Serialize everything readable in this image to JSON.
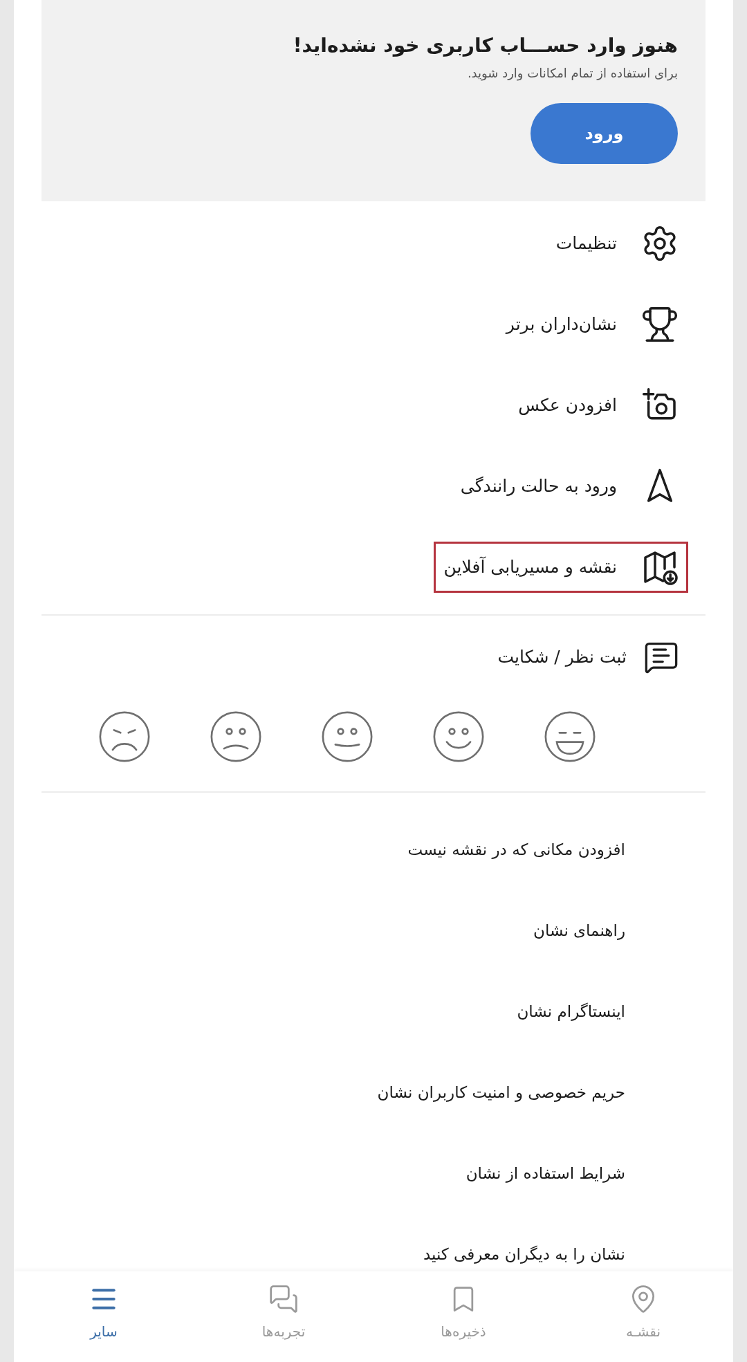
{
  "login_banner": {
    "title": "هنوز وارد حســـاب کاربری خود نشده‌اید!",
    "subtitle": "برای استفاده از تمام امکانات وارد شوید.",
    "button": "ورود"
  },
  "menu_items": [
    {
      "kind": "settings",
      "label": "تنظیمات",
      "highlighted": false
    },
    {
      "kind": "trophy",
      "label": "نشان‌داران برتر",
      "highlighted": false
    },
    {
      "kind": "add-photo",
      "label": "افزودن عکس",
      "highlighted": false
    },
    {
      "kind": "navigation",
      "label": "ورود به حالت رانندگی",
      "highlighted": false
    },
    {
      "kind": "offline-map",
      "label": "نقشه و مسیریابی آفلاین",
      "highlighted": true
    }
  ],
  "feedback": {
    "label": "ثبت نظر / شکایت",
    "faces": [
      {
        "kind": "laughing"
      },
      {
        "kind": "smiling"
      },
      {
        "kind": "neutral"
      },
      {
        "kind": "sad"
      },
      {
        "kind": "angry"
      }
    ]
  },
  "links": [
    "افزودن مکانی که در نقشه نیست",
    "راهنمای نشان",
    "اینستاگرام نشان",
    "حریم خصوصی و امنیت کاربران نشان",
    "شرایط استفاده از نشان",
    "نشان را به دیگران معرفی کنید"
  ],
  "bottom_nav": [
    {
      "kind": "map",
      "label": "نقشـه",
      "selected": false
    },
    {
      "kind": "saved",
      "label": "ذخیره‌ها",
      "selected": false
    },
    {
      "kind": "experiences",
      "label": "تجربه‌ها",
      "selected": false
    },
    {
      "kind": "more",
      "label": "سایر",
      "selected": true
    }
  ]
}
